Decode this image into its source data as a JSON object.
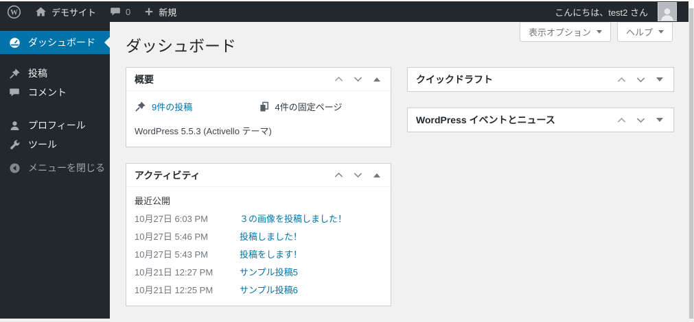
{
  "admin_bar": {
    "site_name": "デモサイト",
    "comment_count": "0",
    "new_label": "新規",
    "greeting": "こんにちは、test2 さん"
  },
  "sidebar": {
    "items": [
      {
        "label": "ダッシュボード",
        "icon": "dashboard-icon",
        "active": true
      },
      {
        "label": "投稿",
        "icon": "pin-icon",
        "active": false
      },
      {
        "label": "コメント",
        "icon": "comment-icon",
        "active": false
      },
      {
        "label": "プロフィール",
        "icon": "user-icon",
        "active": false
      },
      {
        "label": "ツール",
        "icon": "wrench-icon",
        "active": false
      },
      {
        "label": "メニューを閉じる",
        "icon": "collapse-arrow-icon",
        "active": false
      }
    ]
  },
  "page": {
    "title": "ダッシュボード"
  },
  "screen_meta": {
    "screen_options_label": "表示オプション",
    "help_label": "ヘルプ"
  },
  "boxes": {
    "glance": {
      "title": "概要",
      "posts_link": "9件の投稿",
      "pages_label": "4件の固定ページ",
      "version_text": "WordPress 5.5.3 (Activello テーマ)"
    },
    "activity": {
      "title": "アクティビティ",
      "section_label": "最近公開",
      "items": [
        {
          "date": "10月27日 6:03 PM",
          "title": "３の画像を投稿しました！"
        },
        {
          "date": "10月27日 5:46 PM",
          "title": "投稿しました！"
        },
        {
          "date": "10月27日 5:43 PM",
          "title": "投稿をします！"
        },
        {
          "date": "10月21日 12:27 PM",
          "title": "サンプル投稿5"
        },
        {
          "date": "10月21日 12:25 PM",
          "title": "サンプル投稿6"
        }
      ]
    },
    "quick_draft": {
      "title": "クイックドラフト"
    },
    "events_news": {
      "title": "WordPress イベントとニュース"
    }
  },
  "colors": {
    "admin_bar_bg": "#23282d",
    "sidebar_bg": "#23282d",
    "active_menu_bg": "#0073aa",
    "link_blue": "#0073aa",
    "content_bg": "#f1f1f1",
    "box_bg": "#ffffff",
    "box_border": "#ccd0d4"
  }
}
